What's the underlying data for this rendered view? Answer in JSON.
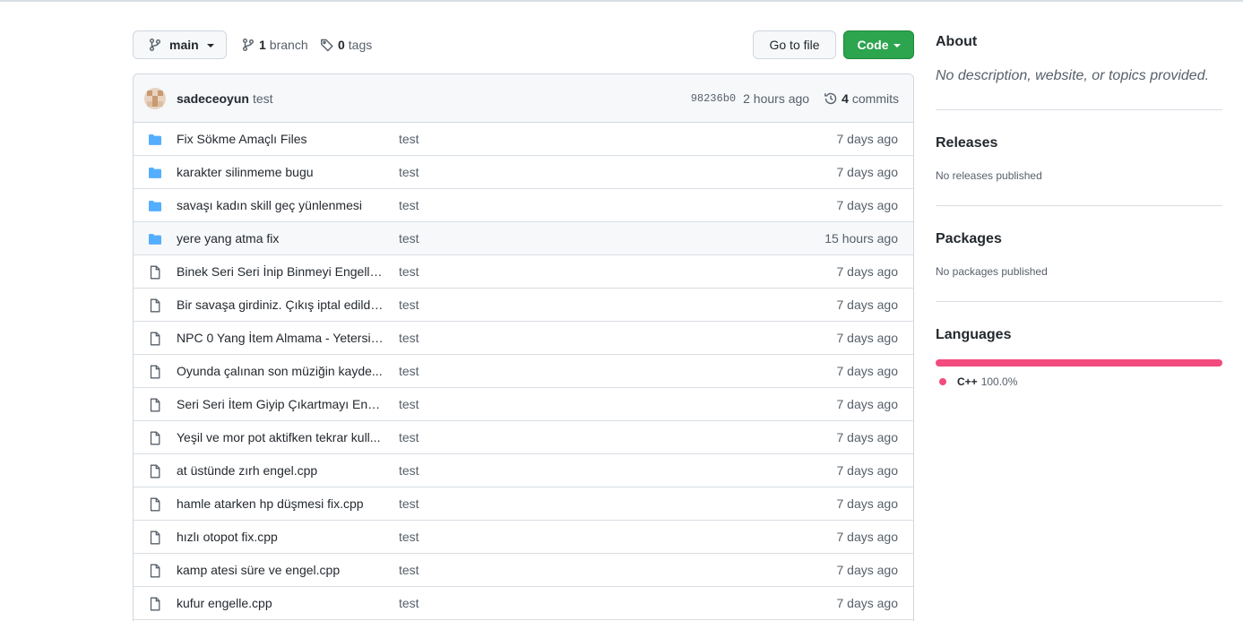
{
  "toolbar": {
    "branch_name": "main",
    "branch_count": "1",
    "branch_label": "branch",
    "tag_count": "0",
    "tag_label": "tags",
    "goto_label": "Go to file",
    "code_label": "Code"
  },
  "commit": {
    "author": "sadeceoyun",
    "message": "test",
    "sha": "98236b0",
    "time": "2 hours ago",
    "count": "4",
    "count_label": "commits"
  },
  "files": [
    {
      "type": "folder",
      "icon": "folder-icon",
      "name": "Fix Sökme Amaçlı Files",
      "message": "test",
      "time": "7 days ago"
    },
    {
      "type": "folder",
      "icon": "folder-icon",
      "name": "karakter silinmeme bugu",
      "message": "test",
      "time": "7 days ago"
    },
    {
      "type": "folder",
      "icon": "folder-icon",
      "name": "savaşı kadın skill geç yünlenmesi",
      "message": "test",
      "time": "7 days ago"
    },
    {
      "type": "folder",
      "icon": "folder-icon",
      "name": "yere yang atma fix",
      "message": "test",
      "time": "15 hours ago"
    },
    {
      "type": "file",
      "icon": "file-icon",
      "name": "Binek Seri Seri İnip Binmeyi Engelle...",
      "message": "test",
      "time": "7 days ago"
    },
    {
      "type": "file",
      "icon": "file-icon",
      "name": "Bir savaşa girdiniz. Çıkış iptal edildi....",
      "message": "test",
      "time": "7 days ago"
    },
    {
      "type": "file",
      "icon": "file-icon",
      "name": "NPC 0 Yang İtem Almama - Yetersiz ...",
      "message": "test",
      "time": "7 days ago"
    },
    {
      "type": "file",
      "icon": "file-icon",
      "name": "Oyunda çalınan son müziğin kayde...",
      "message": "test",
      "time": "7 days ago"
    },
    {
      "type": "file",
      "icon": "file-icon",
      "name": "Seri Seri İtem Giyip Çıkartmayı Enge...",
      "message": "test",
      "time": "7 days ago"
    },
    {
      "type": "file",
      "icon": "file-icon",
      "name": "Yeşil ve mor pot aktifken tekrar kull...",
      "message": "test",
      "time": "7 days ago"
    },
    {
      "type": "file",
      "icon": "file-icon",
      "name": "at üstünde zırh engel.cpp",
      "message": "test",
      "time": "7 days ago"
    },
    {
      "type": "file",
      "icon": "file-icon",
      "name": "hamle atarken hp düşmesi fix.cpp",
      "message": "test",
      "time": "7 days ago"
    },
    {
      "type": "file",
      "icon": "file-icon",
      "name": "hızlı otopot fix.cpp",
      "message": "test",
      "time": "7 days ago"
    },
    {
      "type": "file",
      "icon": "file-icon",
      "name": "kamp atesi süre ve engel.cpp",
      "message": "test",
      "time": "7 days ago"
    },
    {
      "type": "file",
      "icon": "file-icon",
      "name": "kufur engelle.cpp",
      "message": "test",
      "time": "7 days ago"
    }
  ],
  "sidebar": {
    "about_title": "About",
    "about_text": "No description, website, or topics provided.",
    "releases_title": "Releases",
    "releases_text": "No releases published",
    "packages_title": "Packages",
    "packages_text": "No packages published",
    "languages_title": "Languages",
    "languages": [
      {
        "name": "C++",
        "percent": "100.0%",
        "fraction": 1.0,
        "color": "#f34b7d"
      }
    ]
  },
  "colors": {
    "accent_green": "#2da44e",
    "folder_blue": "#54aeff",
    "cpp_pink": "#f34b7d"
  }
}
